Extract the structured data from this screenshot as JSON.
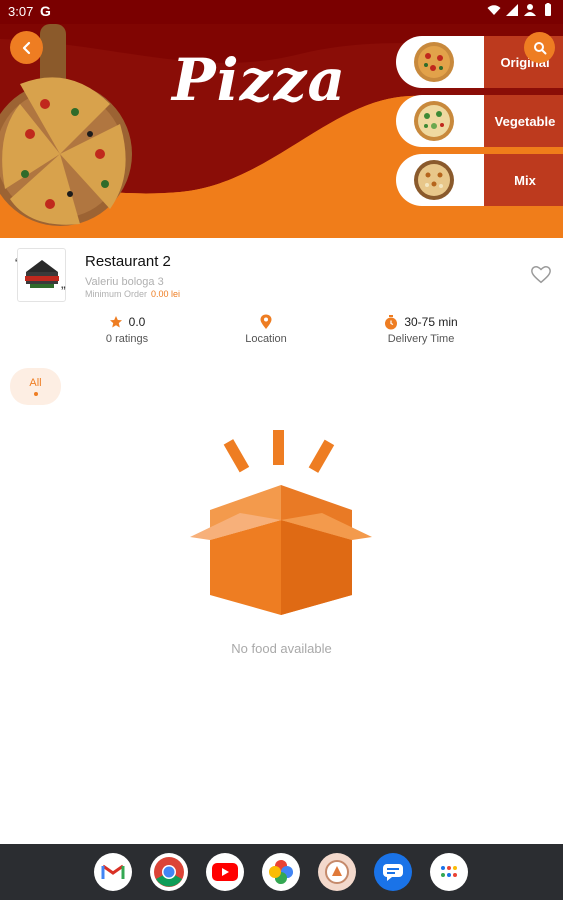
{
  "status_bar": {
    "time": "3:07",
    "g_label": "G"
  },
  "banner": {
    "title": "Pizza",
    "categories": [
      {
        "label": "Original"
      },
      {
        "label": "Vegetable"
      },
      {
        "label": "Mix"
      }
    ]
  },
  "restaurant": {
    "name": "Restaurant 2",
    "address": "Valeriu bologa 3",
    "min_order_label": "Minimum Order",
    "min_order_value": "0.00 lei",
    "quote_open": "“",
    "quote_close": "”"
  },
  "stats": {
    "rating_value": "0.0",
    "rating_label": "0 ratings",
    "location_label": "Location",
    "delivery_value": "30-75 min",
    "delivery_label": "Delivery Time"
  },
  "tabs": [
    {
      "label": "All"
    }
  ],
  "empty_state": {
    "message": "No food available"
  },
  "dock": {
    "apps": [
      "gmail-icon",
      "chrome-icon",
      "youtube-icon",
      "photos-icon",
      "app-icon",
      "messages-icon",
      "app-drawer-icon"
    ]
  },
  "colors": {
    "accent": "#ee7d22",
    "banner_dark": "#7a0000",
    "category_red": "#bd3a1e"
  }
}
